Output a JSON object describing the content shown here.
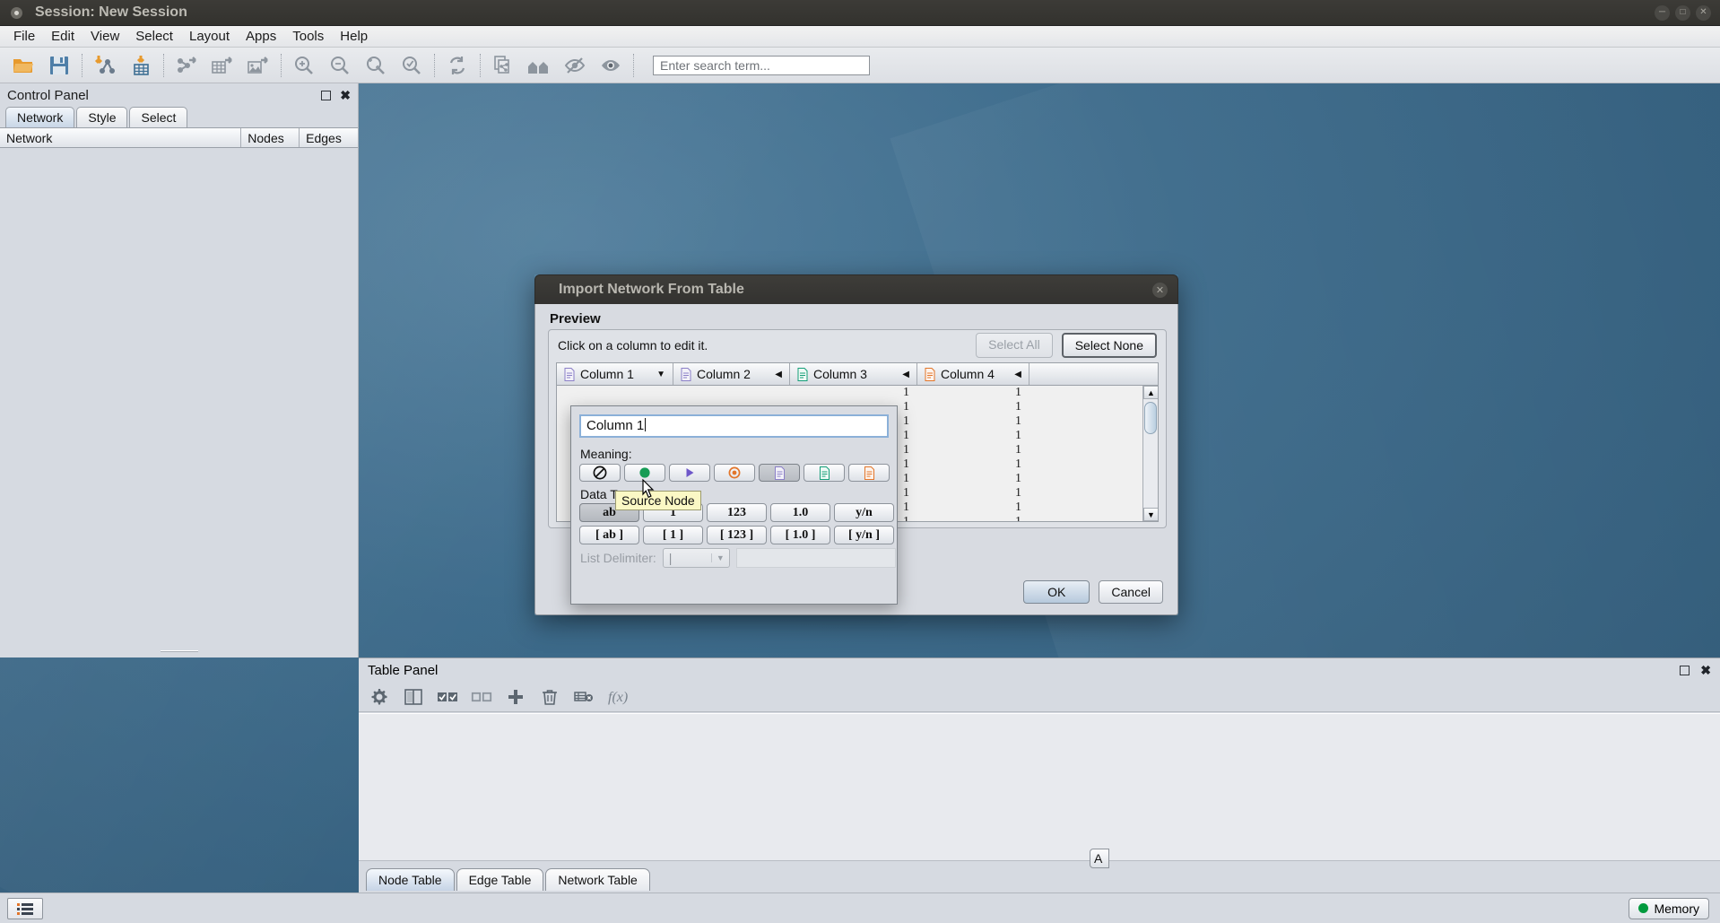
{
  "window": {
    "title": "Session: New Session",
    "controls": [
      "minimize",
      "maximize",
      "close"
    ]
  },
  "menu": {
    "items": [
      "File",
      "Edit",
      "View",
      "Select",
      "Layout",
      "Apps",
      "Tools",
      "Help"
    ]
  },
  "toolbar": {
    "icons": [
      "open-folder-icon",
      "save-icon",
      "import-network-icon",
      "import-table-icon",
      "export-network-icon",
      "export-table-icon",
      "export-image-icon",
      "zoom-in-icon",
      "zoom-out-icon",
      "zoom-fit-icon",
      "zoom-selected-icon",
      "refresh-icon",
      "new-network-from-selection-icon",
      "first-neighbors-icon",
      "hide-selected-icon",
      "show-all-icon"
    ],
    "search_placeholder": "Enter search term..."
  },
  "control_panel": {
    "title": "Control Panel",
    "tabs": [
      {
        "label": "Network",
        "active": true
      },
      {
        "label": "Style",
        "active": false
      },
      {
        "label": "Select",
        "active": false
      }
    ],
    "table_headers": [
      "Network",
      "Nodes",
      "Edges"
    ],
    "rows": []
  },
  "table_panel": {
    "title": "Table Panel",
    "toolbar_icons": [
      "settings-gear-icon",
      "split-columns-icon",
      "select-all-columns-icon",
      "deselect-all-columns-icon",
      "add-column-icon",
      "delete-column-icon",
      "delete-table-icon",
      "function-builder-icon"
    ],
    "tabs": [
      {
        "label": "Node Table",
        "active": true
      },
      {
        "label": "Edge Table",
        "active": false
      },
      {
        "label": "Network Table",
        "active": false
      }
    ]
  },
  "status_bar": {
    "left_icon": "task-list-icon",
    "memory_label": "Memory",
    "memory_color": "#009a3e"
  },
  "dialog": {
    "title": "Import Network From Table",
    "close_icon": "close-icon",
    "section_label": "Preview",
    "hint": "Click on a column to edit it.",
    "select_all_label": "Select All",
    "select_all_disabled": true,
    "select_none_label": "Select None",
    "ok_label": "OK",
    "cancel_label": "Cancel",
    "hidden_button_label": "A",
    "columns": [
      {
        "name": "Column 1",
        "icon_color": "#8b7fc7",
        "arrow": "down"
      },
      {
        "name": "Column 2",
        "icon_color": "#8b7fc7",
        "arrow": "left"
      },
      {
        "name": "Column 3",
        "icon_color": "#149e78",
        "arrow": "left"
      },
      {
        "name": "Column 4",
        "icon_color": "#e2752a",
        "arrow": "left"
      }
    ],
    "preview_rows": [
      [
        "1",
        "1"
      ],
      [
        "1",
        "1"
      ],
      [
        "1",
        "1"
      ],
      [
        "1",
        "1"
      ],
      [
        "1",
        "1"
      ],
      [
        "1",
        "1"
      ],
      [
        "1",
        "1"
      ],
      [
        "1",
        "1"
      ],
      [
        "1",
        "1"
      ],
      [
        "1",
        "1"
      ]
    ],
    "scrollbar": {
      "up_arrow": "▲",
      "down_arrow": "▼"
    }
  },
  "column_editor": {
    "name_value": "Column 1",
    "meaning_label": "Meaning:",
    "meaning_buttons": [
      {
        "name": "not-imported",
        "icon": "no-entry-icon",
        "selected": false
      },
      {
        "name": "source-node",
        "icon": "green-circle-icon",
        "selected": false
      },
      {
        "name": "interaction-type",
        "icon": "purple-triangle-icon",
        "selected": false
      },
      {
        "name": "target-node",
        "icon": "orange-target-icon",
        "selected": false
      },
      {
        "name": "edge-attribute",
        "icon": "purple-document-icon",
        "selected": true
      },
      {
        "name": "source-node-attribute",
        "icon": "green-document-icon",
        "selected": false
      },
      {
        "name": "target-node-attribute",
        "icon": "orange-document-icon",
        "selected": false
      }
    ],
    "data_type_label": "Data Type:",
    "data_types_row1": [
      {
        "label": "ab",
        "selected": true
      },
      {
        "label": "1",
        "selected": false
      },
      {
        "label": "123",
        "selected": false
      },
      {
        "label": "1.0",
        "selected": false
      },
      {
        "label": "y/n",
        "selected": false
      }
    ],
    "data_types_row2": [
      {
        "label": "[ ab ]",
        "selected": false
      },
      {
        "label": "[ 1 ]",
        "selected": false
      },
      {
        "label": "[ 123 ]",
        "selected": false
      },
      {
        "label": "[ 1.0 ]",
        "selected": false
      },
      {
        "label": "[ y/n ]",
        "selected": false
      }
    ],
    "list_delimiter_label": "List Delimiter:",
    "list_delimiter_value": "|",
    "list_delimiter_disabled": true
  },
  "tooltip": {
    "text": "Source Node"
  }
}
